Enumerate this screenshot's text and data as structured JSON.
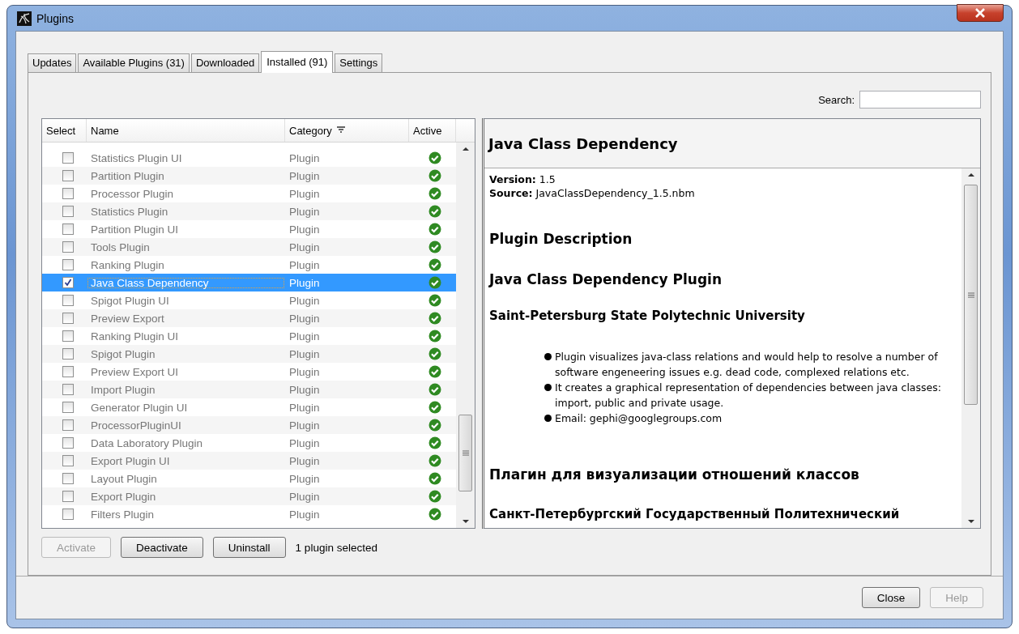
{
  "window": {
    "title": "Plugins"
  },
  "tabs": [
    {
      "label": "Updates",
      "selected": false
    },
    {
      "label": "Available Plugins (31)",
      "selected": false
    },
    {
      "label": "Downloaded",
      "selected": false
    },
    {
      "label": "Installed (91)",
      "selected": true
    },
    {
      "label": "Settings",
      "selected": false
    }
  ],
  "search": {
    "label": "Search:"
  },
  "table": {
    "columns": [
      {
        "label": "Select"
      },
      {
        "label": "Name"
      },
      {
        "label": "Category",
        "sorted": true
      },
      {
        "label": "Active"
      }
    ],
    "rows": [
      {
        "name": "Statistics Plugin UI",
        "category": "Plugin",
        "checked": false,
        "selected": false,
        "active": true
      },
      {
        "name": "Partition Plugin",
        "category": "Plugin",
        "checked": false,
        "selected": false,
        "active": true
      },
      {
        "name": "Processor Plugin",
        "category": "Plugin",
        "checked": false,
        "selected": false,
        "active": true
      },
      {
        "name": "Statistics Plugin",
        "category": "Plugin",
        "checked": false,
        "selected": false,
        "active": true
      },
      {
        "name": "Partition Plugin UI",
        "category": "Plugin",
        "checked": false,
        "selected": false,
        "active": true
      },
      {
        "name": "Tools Plugin",
        "category": "Plugin",
        "checked": false,
        "selected": false,
        "active": true
      },
      {
        "name": "Ranking Plugin",
        "category": "Plugin",
        "checked": false,
        "selected": false,
        "active": true
      },
      {
        "name": "Java Class Dependency",
        "category": "Plugin",
        "checked": true,
        "selected": true,
        "active": true
      },
      {
        "name": "Spigot Plugin UI",
        "category": "Plugin",
        "checked": false,
        "selected": false,
        "active": true
      },
      {
        "name": "Preview Export",
        "category": "Plugin",
        "checked": false,
        "selected": false,
        "active": true
      },
      {
        "name": "Ranking Plugin UI",
        "category": "Plugin",
        "checked": false,
        "selected": false,
        "active": true
      },
      {
        "name": "Spigot Plugin",
        "category": "Plugin",
        "checked": false,
        "selected": false,
        "active": true
      },
      {
        "name": "Preview Export UI",
        "category": "Plugin",
        "checked": false,
        "selected": false,
        "active": true
      },
      {
        "name": "Import Plugin",
        "category": "Plugin",
        "checked": false,
        "selected": false,
        "active": true
      },
      {
        "name": "Generator Plugin UI",
        "category": "Plugin",
        "checked": false,
        "selected": false,
        "active": true
      },
      {
        "name": "ProcessorPluginUI",
        "category": "Plugin",
        "checked": false,
        "selected": false,
        "active": true
      },
      {
        "name": "Data Laboratory Plugin",
        "category": "Plugin",
        "checked": false,
        "selected": false,
        "active": true
      },
      {
        "name": "Export Plugin UI",
        "category": "Plugin",
        "checked": false,
        "selected": false,
        "active": true
      },
      {
        "name": "Layout Plugin",
        "category": "Plugin",
        "checked": false,
        "selected": false,
        "active": true
      },
      {
        "name": "Export Plugin",
        "category": "Plugin",
        "checked": false,
        "selected": false,
        "active": true
      },
      {
        "name": "Filters Plugin",
        "category": "Plugin",
        "checked": false,
        "selected": false,
        "active": true
      }
    ]
  },
  "actions": [
    {
      "label": "Activate",
      "disabled": true
    },
    {
      "label": "Deactivate",
      "disabled": false
    },
    {
      "label": "Uninstall",
      "disabled": false
    }
  ],
  "selection_status": "1 plugin selected",
  "details": {
    "title": "Java Class Dependency",
    "meta": [
      "**Version:** 1.5",
      "**Source:** JavaClassDependency_1.5.nbm"
    ],
    "heading": "Plugin Description",
    "subheading": "Java Class Dependency Plugin",
    "organization": "Saint-Petersburg State Polytechnic University",
    "bullets": [
      "Plugin visualizes java-class relations and would help to resolve a number of software engeneering issues e.g. dead code, complexed relations etc.",
      "It creates a graphical representation of dependencies between java classes: import, public and private usage.",
      "Email: gephi@googlegroups.com"
    ],
    "ru_heading": "Плагин для визуализации отношений классов",
    "ru_organization": "Санкт-Петербургский Государственный Политехнический"
  },
  "footer_buttons": [
    {
      "label": "Close",
      "disabled": false
    },
    {
      "label": "Help",
      "disabled": true
    }
  ]
}
